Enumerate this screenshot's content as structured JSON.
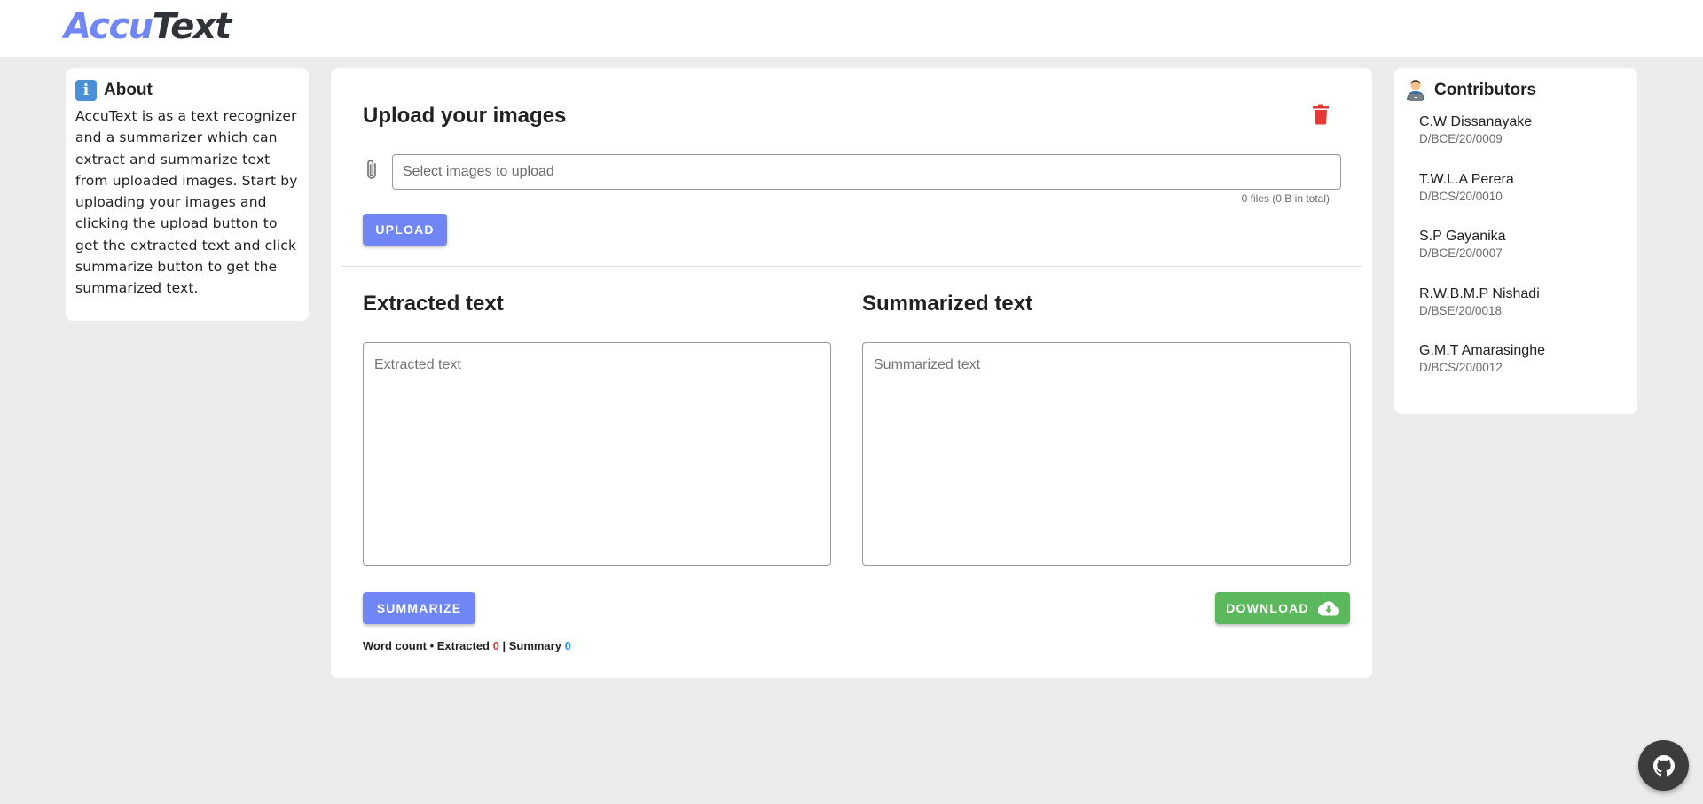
{
  "app": {
    "logo_part1": "Accu",
    "logo_part2": "Text"
  },
  "about": {
    "title": "About",
    "icon": "info-icon",
    "text": "AccuText is as a text recognizer and a summarizer which can extract and summarize text from uploaded images. Start by uploading your images and clicking the upload button to get the extracted text and click summarize button to get the summarized text."
  },
  "upload": {
    "title": "Upload your images",
    "placeholder": "Select images to upload",
    "file_count": "0 files (0 B in total)",
    "button_label": "UPLOAD",
    "clear_icon": "trash-icon",
    "attach_icon": "paperclip-icon"
  },
  "extracted": {
    "title": "Extracted text",
    "placeholder": "Extracted text"
  },
  "summarized": {
    "title": "Summarized text",
    "placeholder": "Summarized text"
  },
  "actions": {
    "summarize_label": "SUMMARIZE",
    "download_label": "DOWNLOAD",
    "download_icon": "cloud-download-icon"
  },
  "word_count": {
    "label": "Word count • Extracted ",
    "extracted": "0",
    "separator": " | Summary ",
    "summary": "0"
  },
  "contributors": {
    "title": "Contributors",
    "icon": "technologist-icon",
    "items": [
      {
        "name": "C.W Dissanayake",
        "id": "D/BCE/20/0009"
      },
      {
        "name": "T.W.L.A Perera",
        "id": "D/BCS/20/0010"
      },
      {
        "name": "S.P Gayanika",
        "id": "D/BCE/20/0007"
      },
      {
        "name": "R.W.B.M.P Nishadi",
        "id": "D/BSE/20/0018"
      },
      {
        "name": "G.M.T Amarasinghe",
        "id": "D/BCS/20/0012"
      }
    ]
  },
  "fab": {
    "icon": "github-icon"
  },
  "colors": {
    "primary": "#6f86f4",
    "download": "#5cb85c",
    "danger": "#e53935",
    "info": "#2196f3",
    "background": "#ececec"
  }
}
